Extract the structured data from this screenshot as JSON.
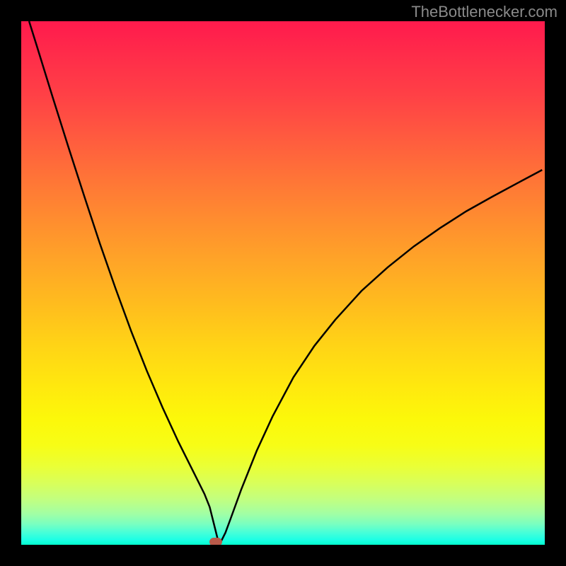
{
  "attribution": "TheBottlenecker.com",
  "chart_data": {
    "type": "line",
    "title": "",
    "xlabel": "",
    "ylabel": "",
    "xlim": [
      0,
      100
    ],
    "ylim": [
      0,
      100
    ],
    "x": [
      1.5,
      3,
      6,
      9,
      12,
      15,
      18,
      21,
      24,
      27,
      30,
      33,
      35,
      36,
      36.5,
      37,
      37.5,
      38,
      39,
      40,
      42,
      45,
      48,
      52,
      56,
      60,
      65,
      70,
      75,
      80,
      85,
      90,
      95,
      99.5
    ],
    "values": [
      100,
      95.2,
      85.5,
      76.0,
      66.7,
      57.6,
      49.0,
      40.8,
      33.2,
      26.2,
      19.7,
      13.7,
      9.7,
      7.2,
      5.2,
      3.2,
      1.2,
      0.3,
      2.3,
      5.0,
      10.5,
      18.0,
      24.5,
      32.0,
      38.0,
      43.0,
      48.5,
      53.0,
      57.0,
      60.5,
      63.7,
      66.5,
      69.2,
      71.6
    ],
    "optimum_marker": {
      "x": 37.2,
      "y": 0.6,
      "color": "#b85a4a"
    }
  },
  "colors": {
    "curve": "#000000",
    "marker": "#b85a4a",
    "frame": "#000000"
  }
}
